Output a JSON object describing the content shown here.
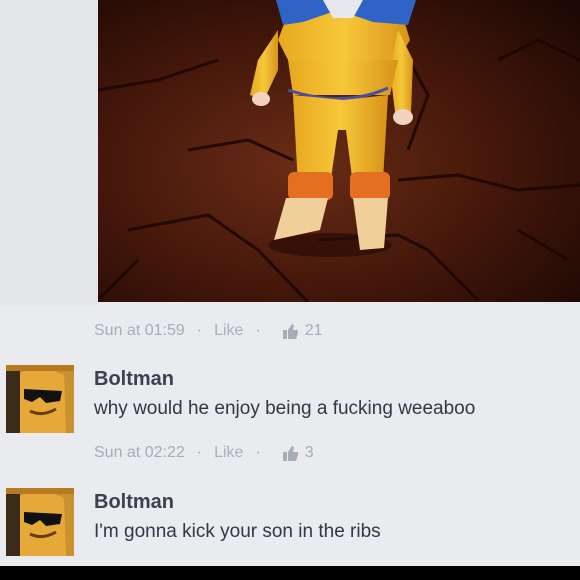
{
  "post": {
    "timestamp": "Sun at 01:59",
    "separator": "·",
    "like_label": "Like",
    "like_count": "21"
  },
  "comments": [
    {
      "author": "Boltman",
      "text": "why would he enjoy being a fucking weeaboo",
      "timestamp": "Sun at 02:22",
      "like_label": "Like",
      "like_count": "3"
    },
    {
      "author": "Boltman",
      "text": "I'm gonna kick your son in the ribs"
    }
  ],
  "icons": {
    "thumbs_up": "thumbs-up-icon"
  },
  "colors": {
    "background": "#e9ebee",
    "meta_text": "#a6adb7",
    "author_text": "#3b4150"
  }
}
